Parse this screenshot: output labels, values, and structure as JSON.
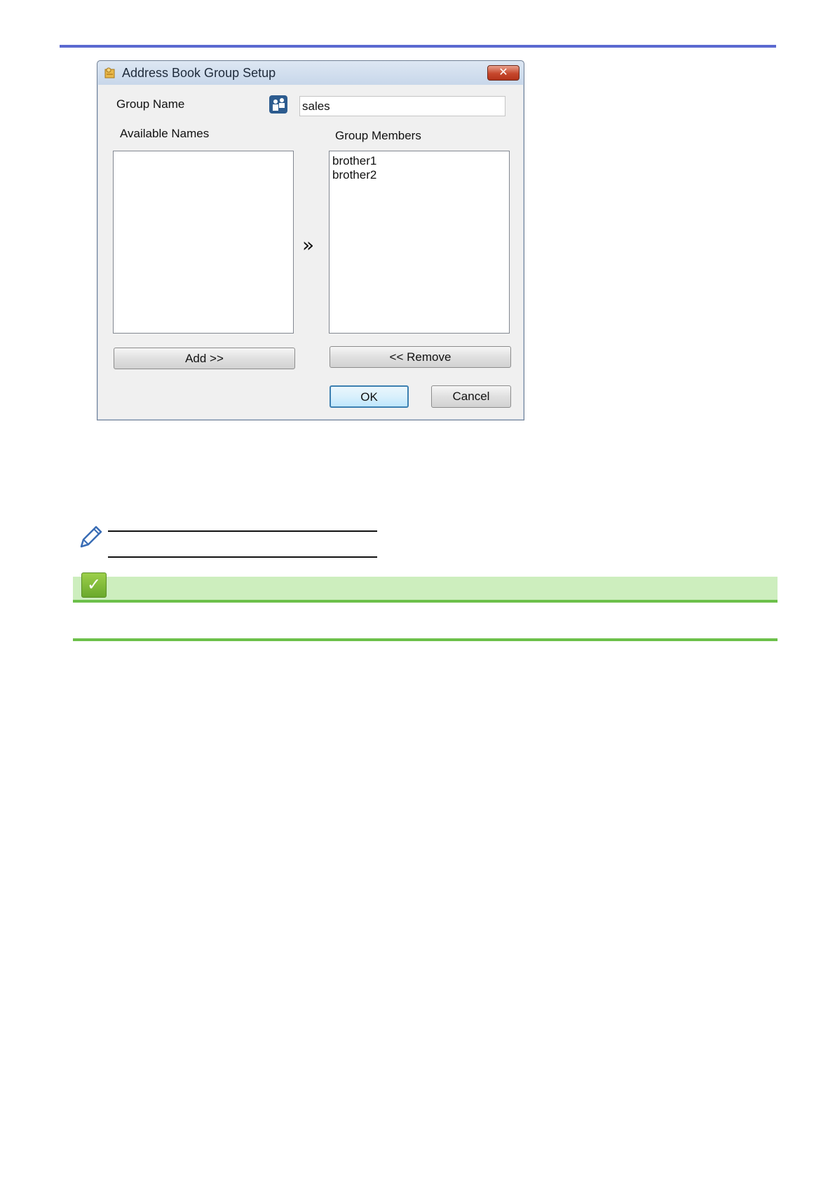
{
  "dialog": {
    "title": "Address Book Group Setup",
    "close_glyph": "✕",
    "group_name_label": "Group Name",
    "group_name_value": "sales",
    "available_label": "Available Names",
    "available_items": [],
    "members_label": "Group Members",
    "members_items": [
      "brother1",
      "brother2"
    ],
    "move_glyph": "»",
    "add_label": "Add >>",
    "remove_label": "<< Remove",
    "ok_label": "OK",
    "cancel_label": "Cancel"
  },
  "related_info": {
    "check_glyph": "✓"
  },
  "colors": {
    "top_rule": "#5b69d0",
    "green_band": "#cdeebe",
    "green_rule": "#6cc04a"
  },
  "icons": [
    "address-book-icon",
    "close-icon",
    "contacts-icon",
    "double-chevron-right-icon",
    "pencil-icon",
    "checkmark-icon"
  ]
}
